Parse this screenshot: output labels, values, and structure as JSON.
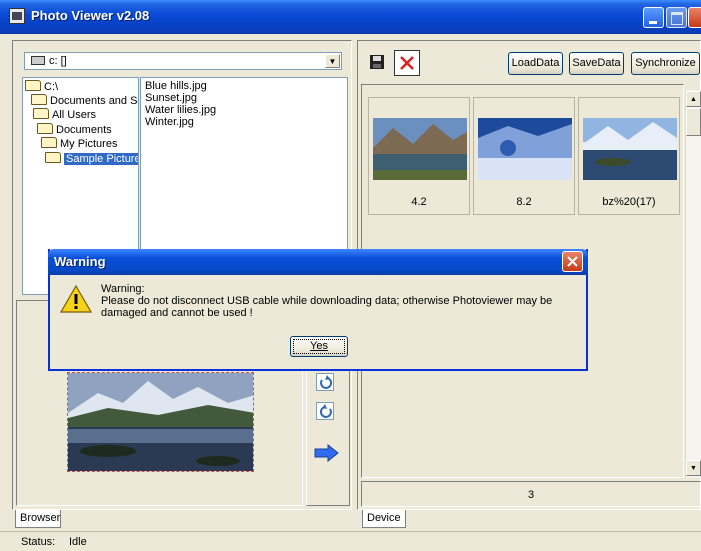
{
  "window": {
    "title": "Photo Viewer v2.08"
  },
  "browser": {
    "drive": "c: []",
    "tree": [
      "C:\\",
      "Documents and Settings",
      "All Users",
      "Documents",
      "My Pictures",
      "Sample Pictures"
    ],
    "files": [
      "Blue hills.jpg",
      "Sunset.jpg",
      "Water lilies.jpg",
      "Winter.jpg"
    ],
    "tab_label": "Browser"
  },
  "device": {
    "buttons": {
      "load": "LoadData",
      "save": "SaveData",
      "sync": "Synchronize"
    },
    "thumbnails": [
      {
        "caption": "4.2"
      },
      {
        "caption": "8.2"
      },
      {
        "caption": "bz%20(17)"
      }
    ],
    "count": "3",
    "tab_label": "Device"
  },
  "dialog": {
    "title": "Warning",
    "heading": "Warning:",
    "message": "Please do not disconnect USB cable while downloading data; otherwise Photoviewer may be damaged and cannot be used !",
    "yes_label": "Yes"
  },
  "status": {
    "label": "Status:",
    "value": "Idle"
  },
  "icons": [
    "app-icon",
    "drive-icon",
    "folder-icon",
    "floppy-save-icon",
    "delete-x-icon",
    "rotate-left-icon",
    "rotate-right-icon",
    "arrow-right-icon",
    "warning-icon"
  ],
  "colors": {
    "title_bar": "#0a4bd8",
    "selection": "#316ac5",
    "delete_red": "#e02020"
  }
}
